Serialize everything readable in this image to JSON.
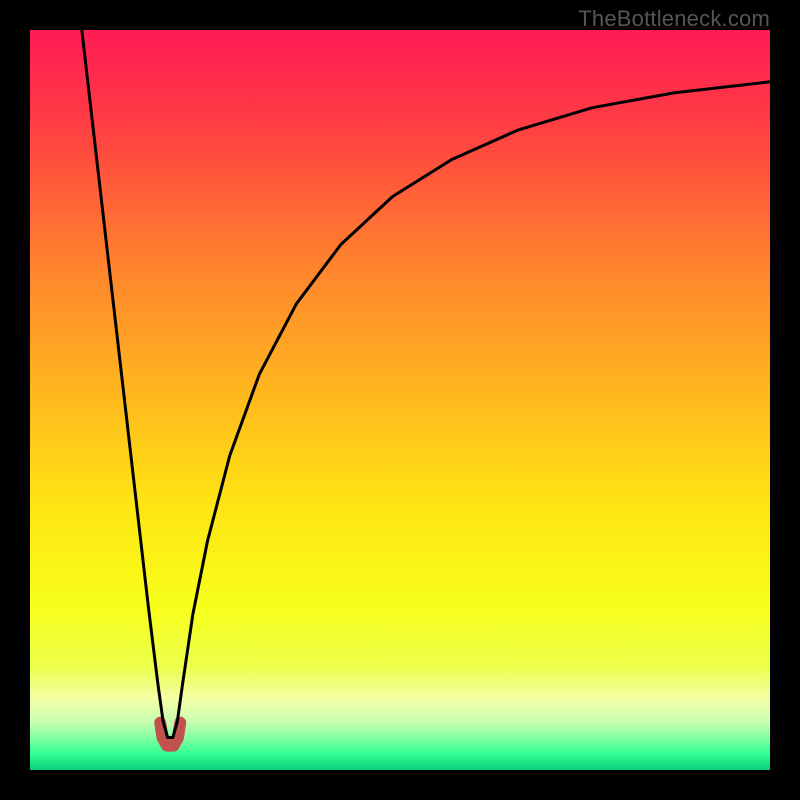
{
  "watermark": {
    "text": "TheBottleneck.com"
  },
  "chart_data": {
    "type": "line",
    "title": "",
    "xlabel": "",
    "ylabel": "",
    "xlim": [
      0,
      100
    ],
    "ylim": [
      0,
      100
    ],
    "grid": false,
    "legend": false,
    "background_gradient_stops": [
      {
        "pos": 0.0,
        "color": "#ff1b55"
      },
      {
        "pos": 0.12,
        "color": "#ff3b44"
      },
      {
        "pos": 0.3,
        "color": "#ff7d2f"
      },
      {
        "pos": 0.48,
        "color": "#ffb41f"
      },
      {
        "pos": 0.64,
        "color": "#ffe413"
      },
      {
        "pos": 0.78,
        "color": "#f7ff1a"
      },
      {
        "pos": 0.86,
        "color": "#ecff4c"
      },
      {
        "pos": 0.905,
        "color": "#f2ffa8"
      },
      {
        "pos": 0.935,
        "color": "#c7ffb0"
      },
      {
        "pos": 0.958,
        "color": "#7fffa0"
      },
      {
        "pos": 0.978,
        "color": "#33ff94"
      },
      {
        "pos": 1.0,
        "color": "#0cce7a"
      }
    ],
    "series": [
      {
        "name": "bottleneck-curve",
        "stroke": "#000000",
        "stroke_width": 3,
        "points": [
          {
            "x": 7.0,
            "y": 100.0
          },
          {
            "x": 8.5,
            "y": 87.0
          },
          {
            "x": 10.0,
            "y": 74.0
          },
          {
            "x": 11.5,
            "y": 61.0
          },
          {
            "x": 13.0,
            "y": 48.0
          },
          {
            "x": 14.5,
            "y": 35.0
          },
          {
            "x": 16.0,
            "y": 22.0
          },
          {
            "x": 17.3,
            "y": 11.5
          },
          {
            "x": 18.0,
            "y": 6.5
          },
          {
            "x": 18.6,
            "y": 4.4
          },
          {
            "x": 19.3,
            "y": 4.4
          },
          {
            "x": 19.9,
            "y": 6.5
          },
          {
            "x": 20.6,
            "y": 11.5
          },
          {
            "x": 22.0,
            "y": 21.0
          },
          {
            "x": 24.0,
            "y": 31.0
          },
          {
            "x": 27.0,
            "y": 42.5
          },
          {
            "x": 31.0,
            "y": 53.5
          },
          {
            "x": 36.0,
            "y": 63.0
          },
          {
            "x": 42.0,
            "y": 71.0
          },
          {
            "x": 49.0,
            "y": 77.5
          },
          {
            "x": 57.0,
            "y": 82.5
          },
          {
            "x": 66.0,
            "y": 86.5
          },
          {
            "x": 76.0,
            "y": 89.5
          },
          {
            "x": 87.0,
            "y": 91.5
          },
          {
            "x": 100.0,
            "y": 93.0
          }
        ]
      },
      {
        "name": "min-marker",
        "stroke": "#c1524e",
        "stroke_width": 12,
        "linecap": "round",
        "points": [
          {
            "x": 17.6,
            "y": 6.4
          },
          {
            "x": 17.9,
            "y": 4.4
          },
          {
            "x": 18.5,
            "y": 3.3
          },
          {
            "x": 19.4,
            "y": 3.3
          },
          {
            "x": 20.0,
            "y": 4.4
          },
          {
            "x": 20.3,
            "y": 6.4
          }
        ]
      }
    ]
  }
}
